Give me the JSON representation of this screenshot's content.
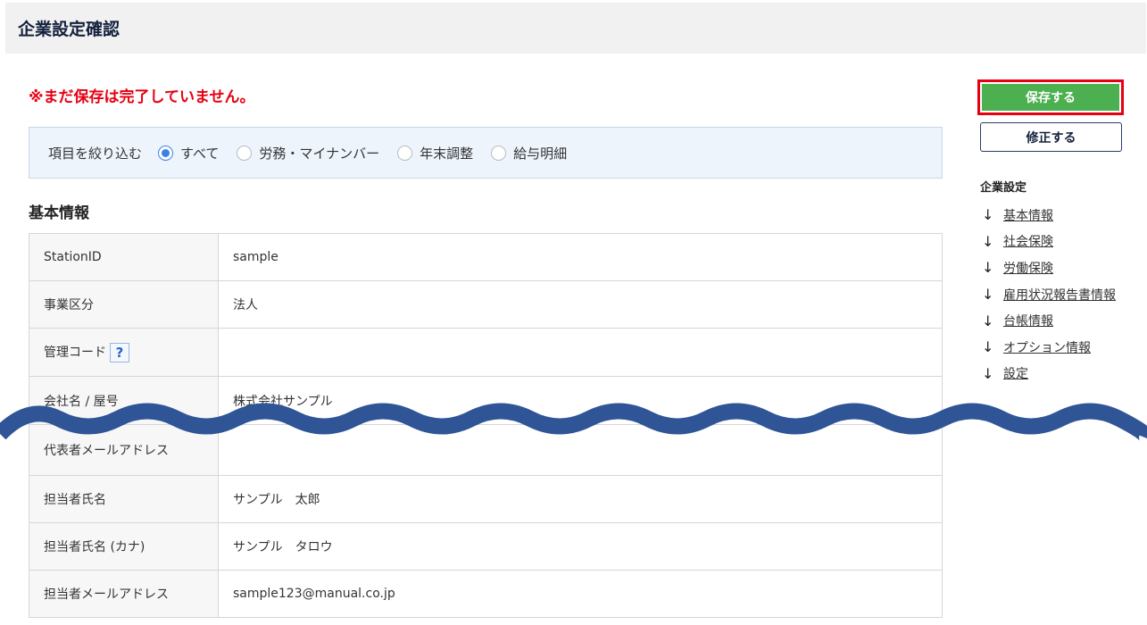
{
  "header": {
    "title": "企業設定確認"
  },
  "warning": "※まだ保存は完了していません。",
  "filter": {
    "label": "項目を絞り込む",
    "options": [
      {
        "label": "すべて",
        "checked": true
      },
      {
        "label": "労務・マイナンバー",
        "checked": false
      },
      {
        "label": "年末調整",
        "checked": false
      },
      {
        "label": "給与明細",
        "checked": false
      }
    ]
  },
  "section": {
    "title": "基本情報"
  },
  "table": {
    "rows": [
      {
        "label": "StationID",
        "value": "sample"
      },
      {
        "label": "事業区分",
        "value": "法人"
      },
      {
        "label": "管理コード",
        "value": "",
        "help": "?"
      },
      {
        "label": "会社名 / 屋号",
        "value": "株式会社サンプル"
      },
      {
        "label": "代表者メールアドレス",
        "value": ""
      },
      {
        "label": "担当者氏名",
        "value": "サンプル　太郎"
      },
      {
        "label": "担当者氏名 (カナ)",
        "value": "サンプル　タロウ"
      },
      {
        "label": "担当者メールアドレス",
        "value": "sample123@manual.co.jp"
      }
    ]
  },
  "actions": {
    "save_label": "保存する",
    "edit_label": "修正する"
  },
  "toc": {
    "heading": "企業設定",
    "items": [
      "基本情報",
      "社会保険",
      "労働保険",
      "雇用状況報告書情報",
      "台帳情報",
      "オプション情報",
      "設定"
    ]
  },
  "colors": {
    "accent": "#4caf50",
    "warning": "#e60012",
    "wave": "#2f5597"
  }
}
